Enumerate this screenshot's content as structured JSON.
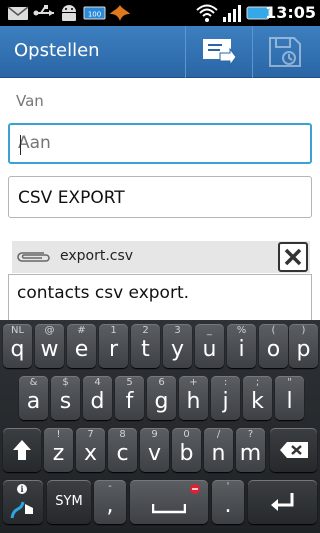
{
  "status_bar": {
    "time": "13:05",
    "battery_icon_text": "100",
    "icons": [
      "email-icon",
      "usb-icon",
      "android-icon",
      "battery-full-icon",
      "notification-icon",
      "wifi-icon",
      "signal-icon",
      "battery-icon"
    ]
  },
  "action_bar": {
    "title": "Opstellen",
    "send_icon": "send-icon",
    "save_draft_icon": "save-draft-icon"
  },
  "compose": {
    "from_label": "Van",
    "to_placeholder": "Aan",
    "subject": "CSV EXPORT",
    "attachment_name": "export.csv",
    "body": "contacts csv export."
  },
  "keyboard": {
    "row1": [
      {
        "main": "q",
        "hint": "NL"
      },
      {
        "main": "w",
        "hint": "@"
      },
      {
        "main": "e",
        "hint": "#"
      },
      {
        "main": "r",
        "hint": "1"
      },
      {
        "main": "t",
        "hint": "2"
      },
      {
        "main": "y",
        "hint": "3"
      },
      {
        "main": "u",
        "hint": "_"
      },
      {
        "main": "i",
        "hint": "%"
      },
      {
        "main": "o",
        "hint": "("
      },
      {
        "main": "p",
        "hint": ")"
      }
    ],
    "row2": [
      {
        "main": "a",
        "hint": "&"
      },
      {
        "main": "s",
        "hint": "$"
      },
      {
        "main": "d",
        "hint": "4"
      },
      {
        "main": "f",
        "hint": "5"
      },
      {
        "main": "g",
        "hint": "6"
      },
      {
        "main": "h",
        "hint": "+"
      },
      {
        "main": "j",
        "hint": ":"
      },
      {
        "main": "k",
        "hint": ";"
      },
      {
        "main": "l",
        "hint": "\""
      }
    ],
    "row3": [
      {
        "main": "z",
        "hint": "!"
      },
      {
        "main": "x",
        "hint": "7"
      },
      {
        "main": "c",
        "hint": "8"
      },
      {
        "main": "v",
        "hint": "9"
      },
      {
        "main": "b",
        "hint": "0"
      },
      {
        "main": "n",
        "hint": "/"
      },
      {
        "main": "m",
        "hint": "?"
      }
    ],
    "sym_label": "SYM",
    "comma_main": ",",
    "comma_hint": "-",
    "period_main": ".",
    "period_hint": "'"
  },
  "colors": {
    "action_bar": "#2f6db0",
    "focus_border": "#3aa2d6",
    "keyboard_bg": "#25282b"
  }
}
